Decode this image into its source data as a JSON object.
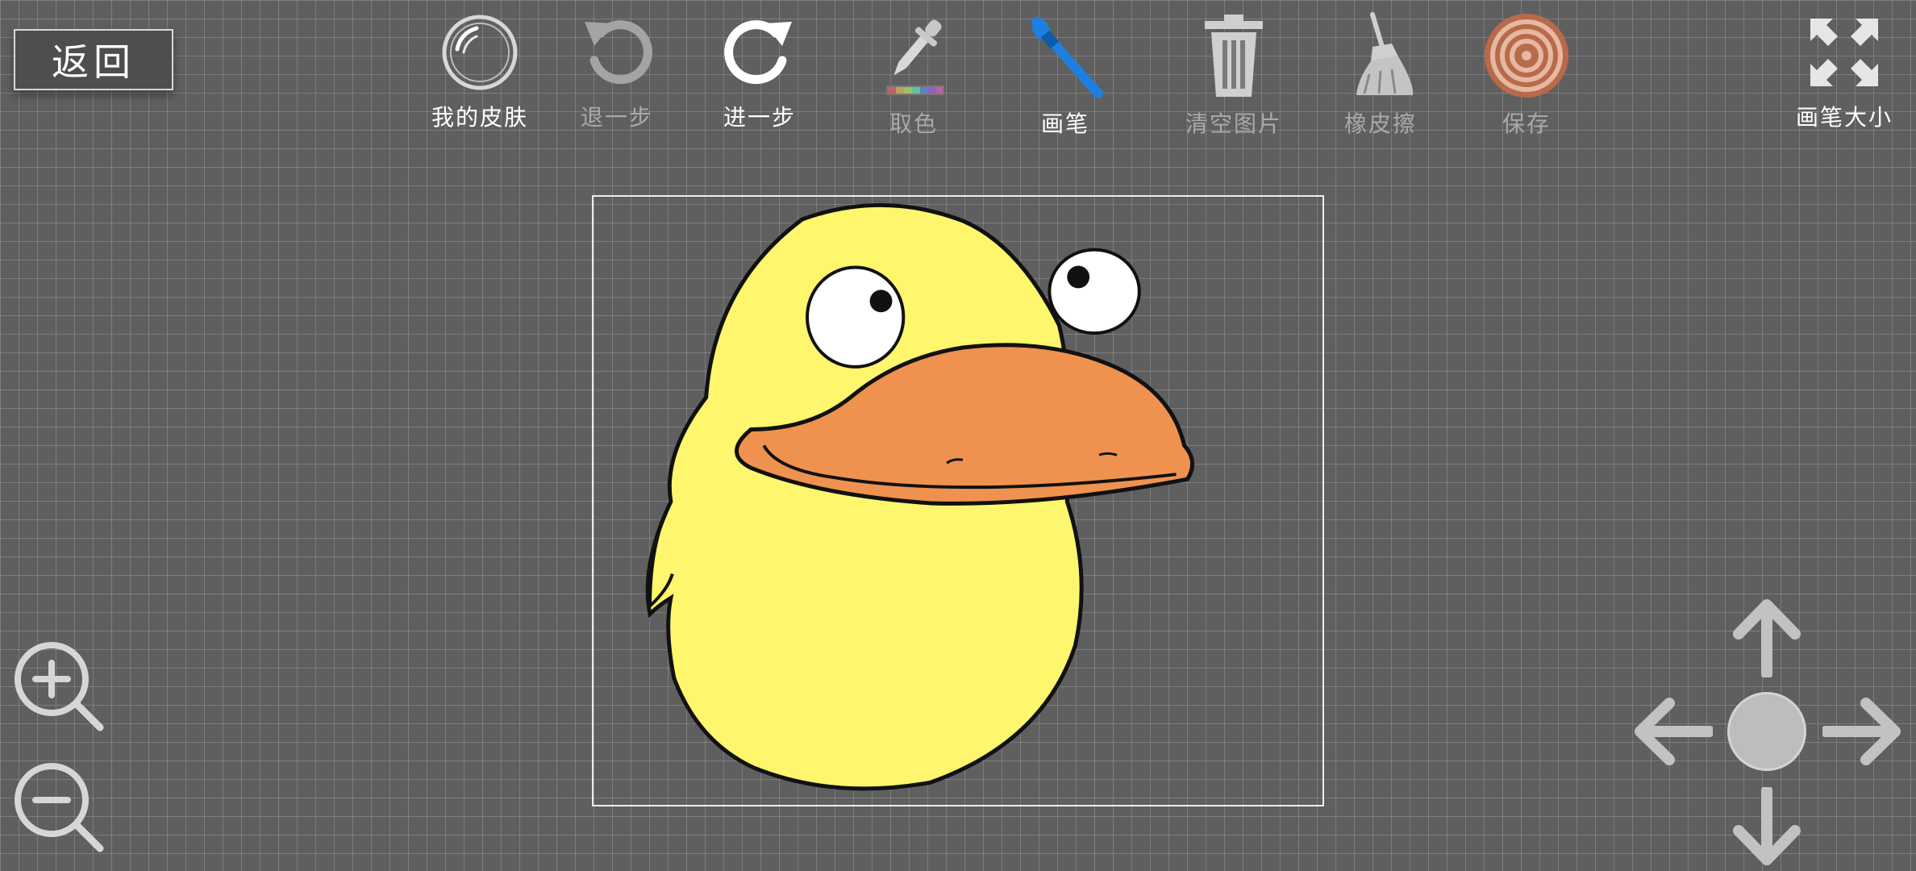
{
  "nav": {
    "back_label": "返回"
  },
  "toolbar": {
    "my_skin": "我的皮肤",
    "undo": "退一步",
    "redo": "进一步",
    "pick_color": "取色",
    "brush": "画笔",
    "clear": "清空图片",
    "eraser": "橡皮擦",
    "save": "保存",
    "brush_size": "画笔大小"
  },
  "icons": {
    "my_skin": "crystal-ball-icon",
    "undo": "undo-arrow-icon",
    "redo": "redo-arrow-icon",
    "pick_color": "eyedropper-icon",
    "brush": "paintbrush-icon",
    "clear": "trash-can-icon",
    "eraser": "broom-icon",
    "save": "target-icon",
    "brush_size": "expand-arrows-icon",
    "zoom_in": "zoom-in-icon",
    "zoom_out": "zoom-out-icon"
  },
  "colors": {
    "background": "#5f5f5f",
    "duck_body": "#fef66c",
    "duck_beak": "#ef924f",
    "brush_accent": "#1f7fe0",
    "save_accent": "#b86a4a"
  }
}
